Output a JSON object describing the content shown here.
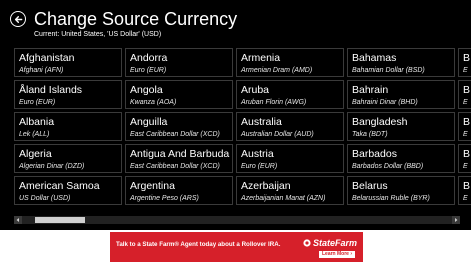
{
  "header": {
    "title": "Change Source Currency",
    "current": "Current: United States, 'US Dollar' (USD)"
  },
  "countries": [
    {
      "name": "Afghanistan",
      "currency": "Afghani (AFN)"
    },
    {
      "name": "Åland Islands",
      "currency": "Euro (EUR)"
    },
    {
      "name": "Albania",
      "currency": "Lek (ALL)"
    },
    {
      "name": "Algeria",
      "currency": "Algerian Dinar (DZD)"
    },
    {
      "name": "American Samoa",
      "currency": "US Dollar (USD)"
    },
    {
      "name": "Andorra",
      "currency": "Euro (EUR)"
    },
    {
      "name": "Angola",
      "currency": "Kwanza (AOA)"
    },
    {
      "name": "Anguilla",
      "currency": "East Caribbean Dollar (XCD)"
    },
    {
      "name": "Antigua And Barbuda",
      "currency": "East Caribbean Dollar (XCD)"
    },
    {
      "name": "Argentina",
      "currency": "Argentine Peso (ARS)"
    },
    {
      "name": "Armenia",
      "currency": "Armenian Dram (AMD)"
    },
    {
      "name": "Aruba",
      "currency": "Aruban Florin (AWG)"
    },
    {
      "name": "Australia",
      "currency": "Australian Dollar (AUD)"
    },
    {
      "name": "Austria",
      "currency": "Euro (EUR)"
    },
    {
      "name": "Azerbaijan",
      "currency": "Azerbaijanian Manat (AZN)"
    },
    {
      "name": "Bahamas",
      "currency": "Bahamian Dollar (BSD)"
    },
    {
      "name": "Bahrain",
      "currency": "Bahraini Dinar (BHD)"
    },
    {
      "name": "Bangladesh",
      "currency": "Taka (BDT)"
    },
    {
      "name": "Barbados",
      "currency": "Barbados Dollar (BBD)"
    },
    {
      "name": "Belarus",
      "currency": "Belarussian Ruble (BYR)"
    },
    {
      "name": "B",
      "currency": "E"
    },
    {
      "name": "B",
      "currency": "E"
    },
    {
      "name": "B",
      "currency": "E"
    },
    {
      "name": "B",
      "currency": "E"
    },
    {
      "name": "B",
      "currency": "E"
    }
  ],
  "scrollbar": {
    "position": 0.03
  },
  "ad": {
    "text": "Talk to a State Farm® Agent today about a Rollover IRA.",
    "brand": "StateFarm",
    "cta": "Learn More ›"
  },
  "colors": {
    "background": "#000000",
    "tile_border": "#3a3a3a",
    "ad_red": "#d6202a"
  },
  "icons": {
    "back": "back-arrow-circle-icon",
    "scroll_left": "scroll-left-arrow-icon",
    "scroll_right": "scroll-right-arrow-icon"
  }
}
